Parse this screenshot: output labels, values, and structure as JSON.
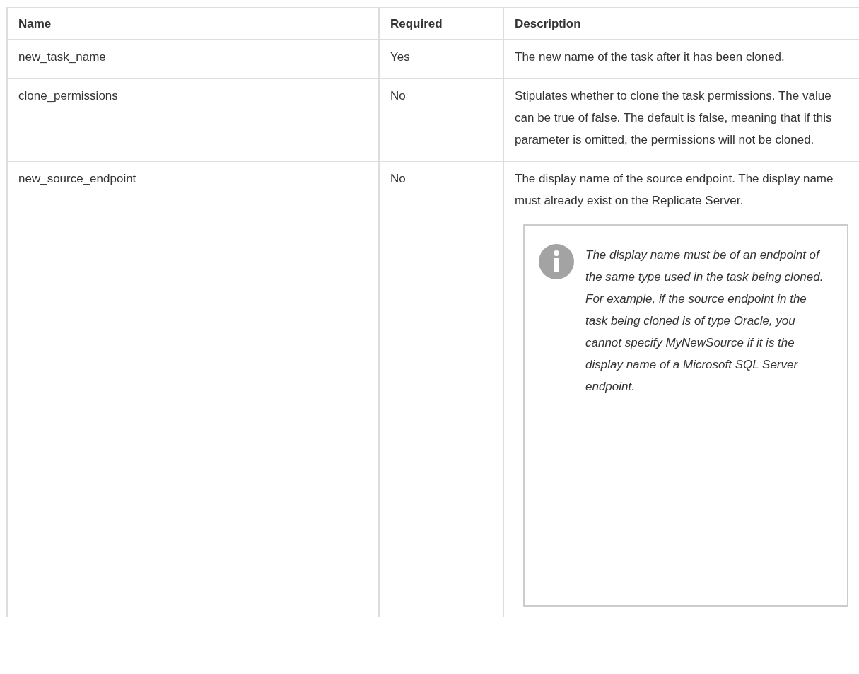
{
  "table": {
    "columns": [
      "Name",
      "Required",
      "Description"
    ],
    "rows": [
      {
        "name": "new_task_name",
        "required": "Yes",
        "description": "The new name of the task after it has been cloned."
      },
      {
        "name": "clone_permissions",
        "required": "No",
        "description": "Stipulates whether to clone the task permissions. The value can be true of false. The default is false, meaning that if this parameter is omitted, the permissions will not be cloned."
      },
      {
        "name": "new_source_endpoint",
        "required": "No",
        "description": "The display name of the source endpoint. The display name must already exist on the Replicate Server.",
        "note": "The display name must be of an endpoint of the same type used in the task being cloned. For example, if the source endpoint in the task being cloned is of type Oracle, you cannot specify MyNewSource if it is the display name of a Microsoft SQL Server endpoint."
      }
    ]
  }
}
